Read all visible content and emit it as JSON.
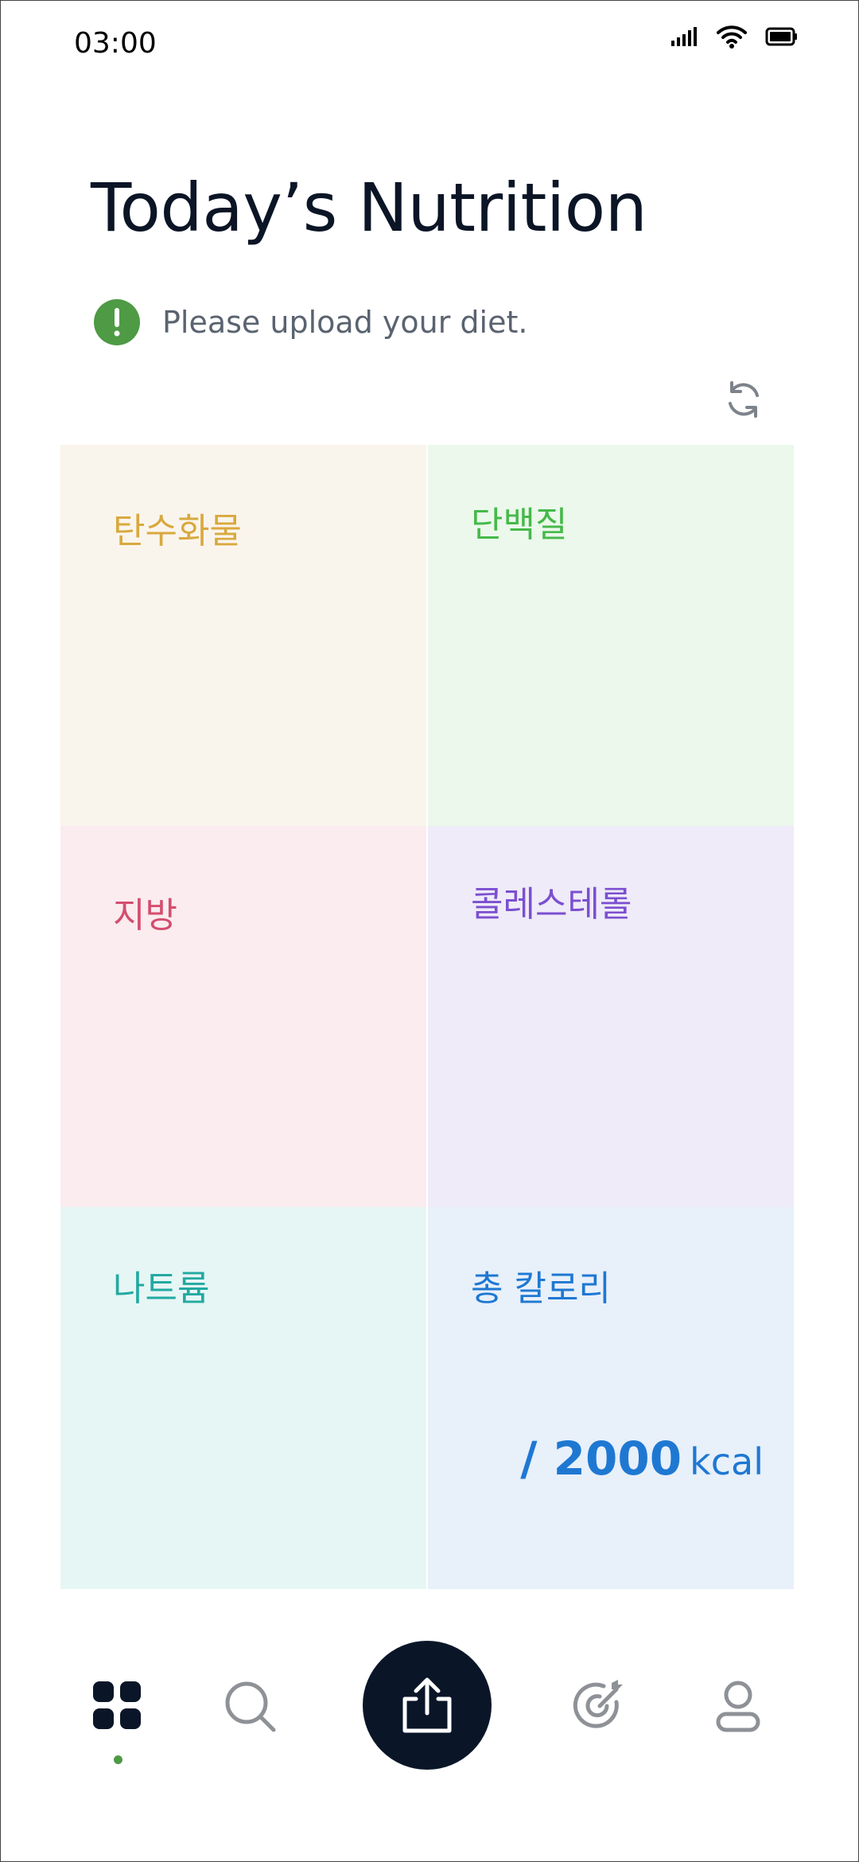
{
  "status_bar": {
    "time": "03:00"
  },
  "header": {
    "title": "Today’s Nutrition",
    "notice": "Please upload your diet."
  },
  "nutrients": {
    "carbs": {
      "label": "탄수화물",
      "color": "#d9a93f",
      "bg": "#faf5ec"
    },
    "protein": {
      "label": "단백질",
      "color": "#45b94a",
      "bg": "#ebf8eb"
    },
    "fat": {
      "label": "지방",
      "color": "#d44d6f",
      "bg": "#faecef"
    },
    "cholesterol": {
      "label": "콜레스테롤",
      "color": "#7b4fd1",
      "bg": "#efebf8"
    },
    "sodium": {
      "label": "나트륨",
      "color": "#23a9a1",
      "bg": "#e6f6f5"
    },
    "calories": {
      "label": "총 칼로리",
      "color": "#1e78d2",
      "bg": "#e8f0fa",
      "goal": "/ 2000",
      "unit": "kcal"
    }
  },
  "icons": {
    "notice": "exclamation-icon",
    "refresh": "refresh-icon",
    "nav": [
      "dashboard-icon",
      "search-icon",
      "upload-icon",
      "goal-icon",
      "profile-icon"
    ]
  },
  "colors": {
    "accent": "#4e9a45",
    "fab": "#0a1628",
    "nav_inactive": "#8e9196",
    "nav_active": "#0a1628"
  }
}
